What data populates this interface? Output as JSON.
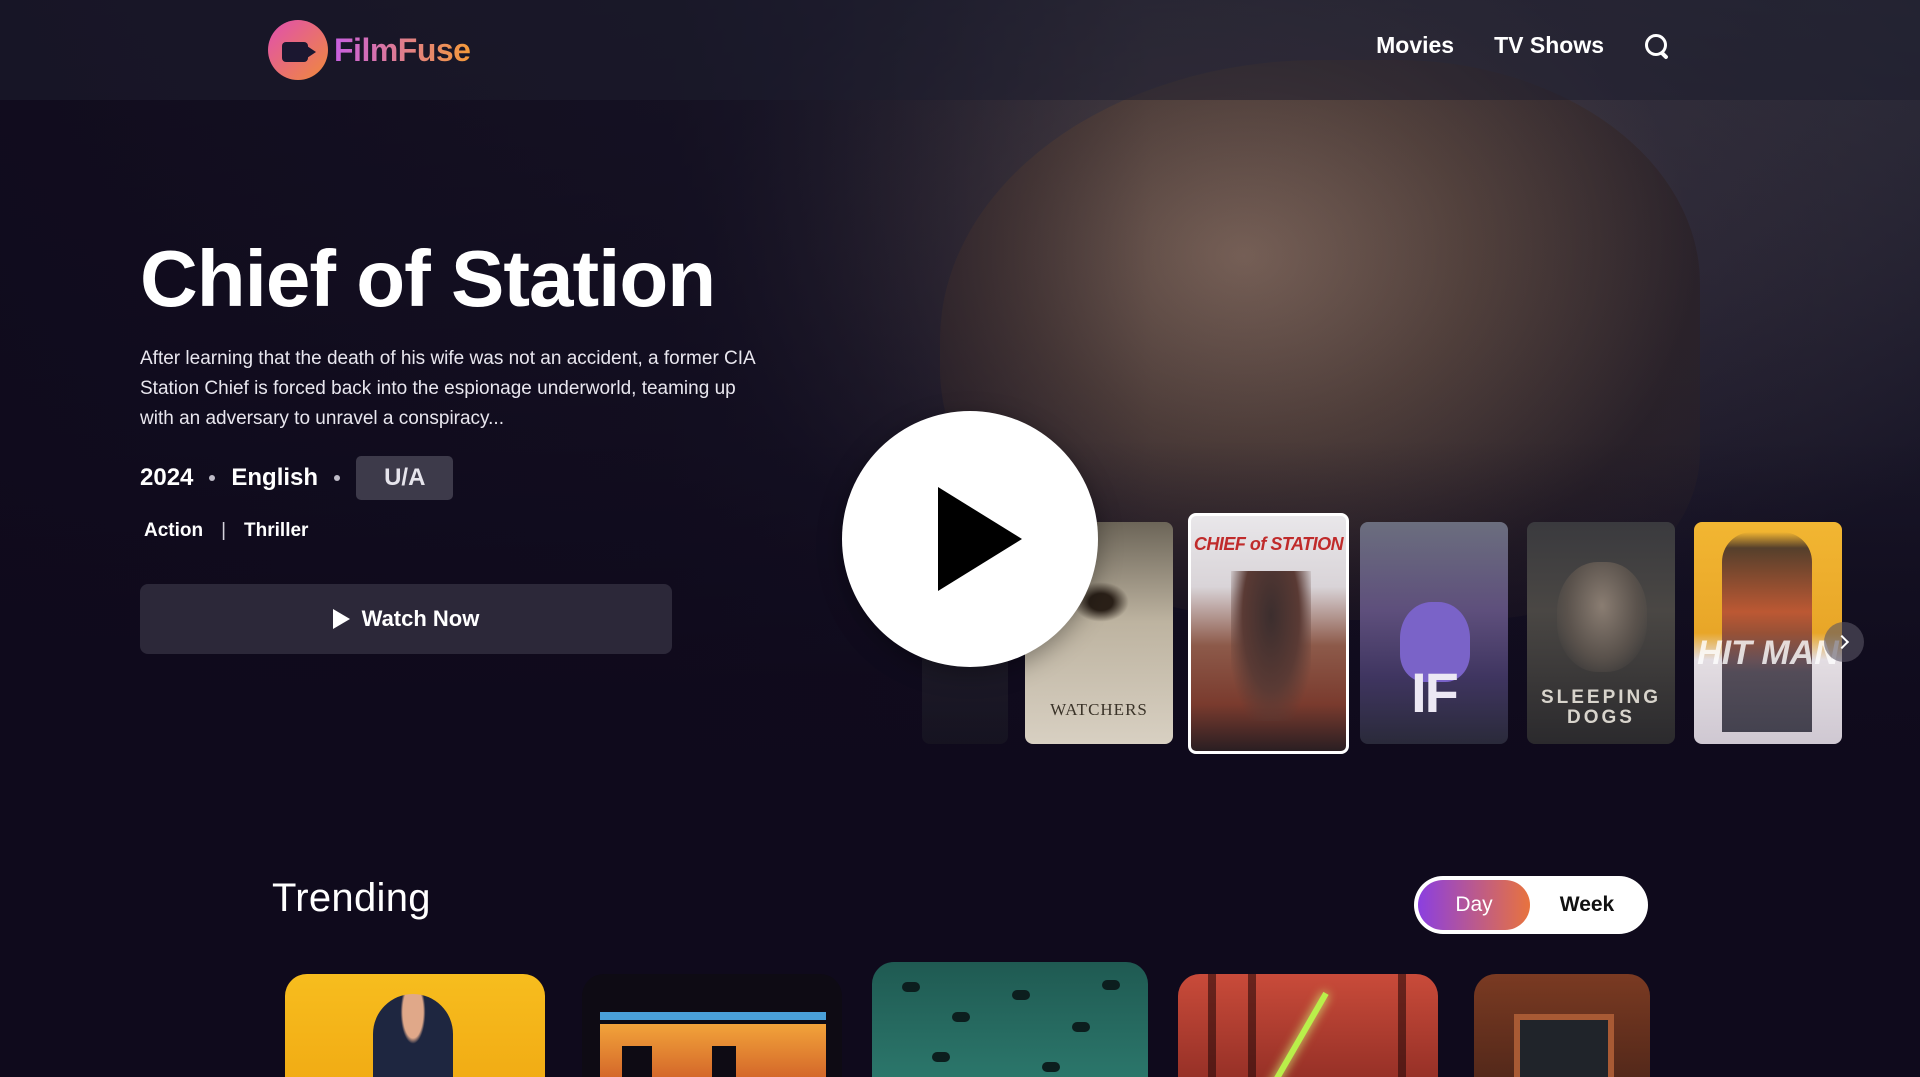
{
  "header": {
    "logo_text": "FilmFuse",
    "nav": [
      {
        "label": "Movies"
      },
      {
        "label": "TV Shows"
      }
    ],
    "search_icon": "search-icon"
  },
  "hero": {
    "title": "Chief of Station",
    "overview": "After learning that the death of his wife was not an accident, a former CIA Station Chief is forced back into the espionage underworld, teaming up with an adversary to unravel a conspiracy...",
    "year": "2024",
    "language": "English",
    "certification": "U/A",
    "genres": [
      "Action",
      "Thriller"
    ],
    "genre_separator": "|",
    "watch_label": "Watch Now"
  },
  "carousel": {
    "posters": [
      {
        "text": ""
      },
      {
        "text": "WATCHERS"
      },
      {
        "text": "CHIEF of STATION",
        "selected": true
      },
      {
        "text": "IF"
      },
      {
        "text": "SLEEPING DOGS"
      },
      {
        "text": "HIT MAN"
      }
    ],
    "next_icon": "chevron-right-icon",
    "play_icon": "play-icon"
  },
  "trending": {
    "title": "Trending",
    "toggle": {
      "day": "Day",
      "week": "Week",
      "selected": "Day"
    }
  },
  "colors": {
    "background": "#0f0a1c",
    "accent_start": "#8b3fe0",
    "accent_end": "#e8733e",
    "button_bg": "#2c2839"
  }
}
